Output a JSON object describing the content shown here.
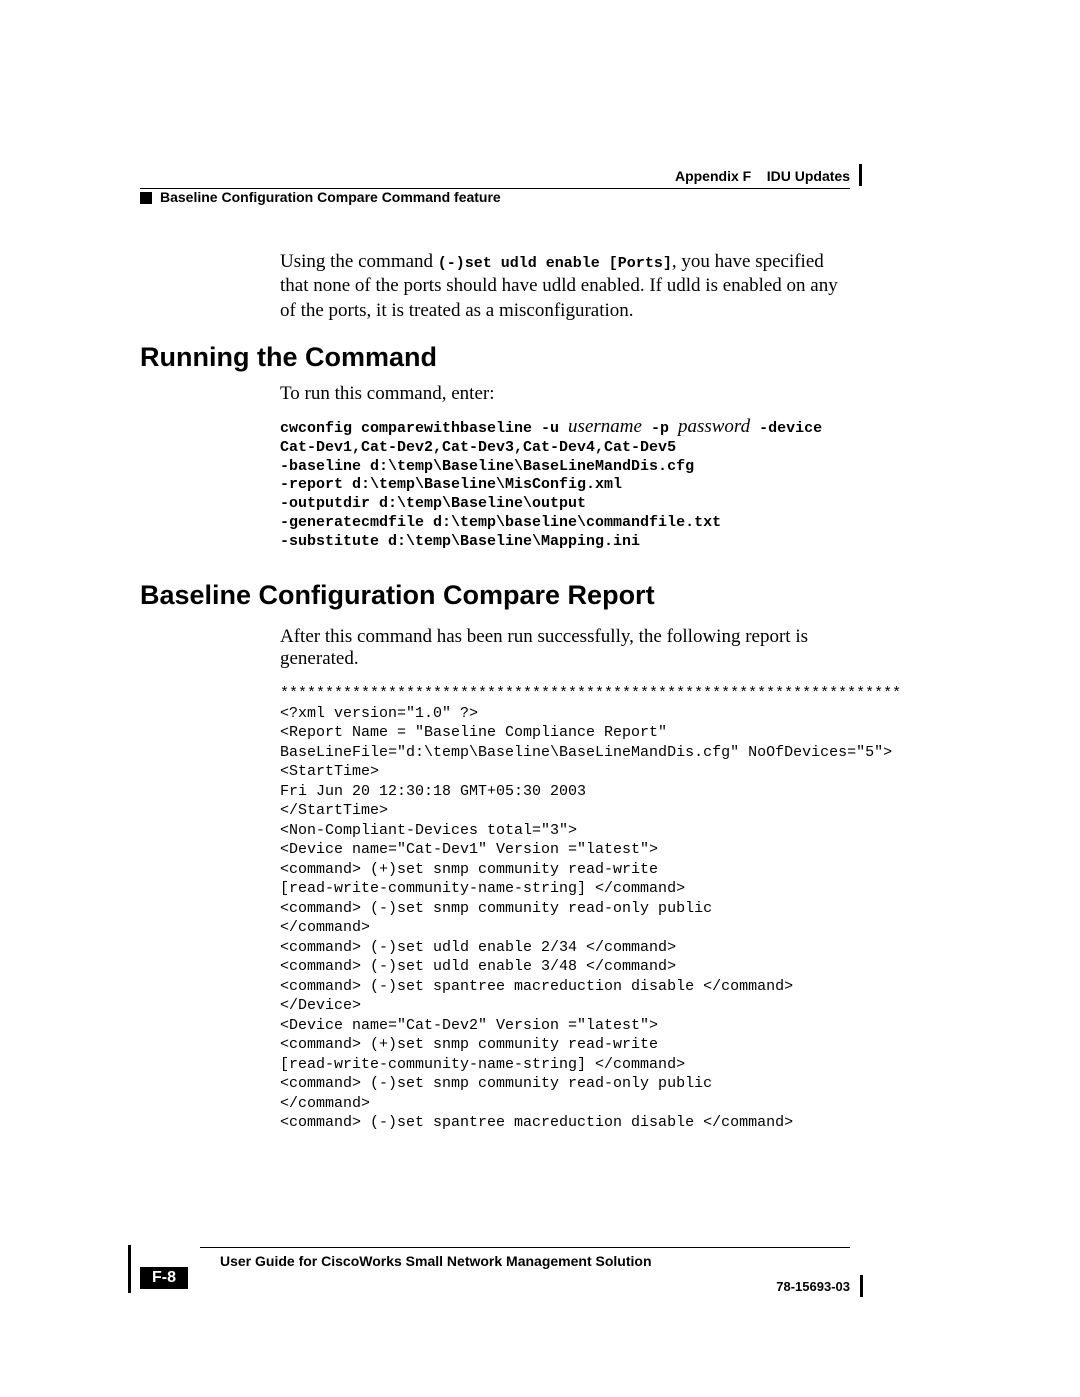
{
  "header": {
    "appendix": "Appendix F",
    "chapter": "IDU Updates",
    "section_marker_text": "Baseline Configuration Compare Command feature"
  },
  "intro": {
    "pre_text": "Using the command ",
    "command": "(-)set udld enable [Ports]",
    "post_text": ", you have specified that none of the ports should have udld enabled. If udld is enabled on any of the ports, it is treated as a misconfiguration."
  },
  "running": {
    "heading": "Running the Command",
    "intro": "To run this command, enter:",
    "l1a": "cwconfig comparewithbaseline -u ",
    "l1_user": "username",
    "l1b": " -p ",
    "l1_pass": "password",
    "l1c": " -device",
    "l2": "Cat-Dev1,Cat-Dev2,Cat-Dev3,Cat-Dev4,Cat-Dev5",
    "l3": "-baseline d:\\temp\\Baseline\\BaseLineMandDis.cfg",
    "l4": "-report d:\\temp\\Baseline\\MisConfig.xml",
    "l5": "-outputdir d:\\temp\\Baseline\\output",
    "l6": "-generatecmdfile d:\\temp\\baseline\\commandfile.txt",
    "l7": "-substitute d:\\temp\\Baseline\\Mapping.ini"
  },
  "report": {
    "heading": "Baseline Configuration Compare Report",
    "intro": "After this command has been run successfully, the following report is generated.",
    "listing": "*********************************************************************\n<?xml version=\"1.0\" ?>\n<Report Name = \"Baseline Compliance Report\"\nBaseLineFile=\"d:\\temp\\Baseline\\BaseLineMandDis.cfg\" NoOfDevices=\"5\">\n<StartTime>\nFri Jun 20 12:30:18 GMT+05:30 2003\n</StartTime>\n<Non-Compliant-Devices total=\"3\">\n<Device name=\"Cat-Dev1\" Version =\"latest\">\n<command> (+)set snmp community read-write\n[read-write-community-name-string] </command>\n<command> (-)set snmp community read-only public\n</command>\n<command> (-)set udld enable 2/34 </command>\n<command> (-)set udld enable 3/48 </command>\n<command> (-)set spantree macreduction disable </command>\n</Device>\n<Device name=\"Cat-Dev2\" Version =\"latest\">\n<command> (+)set snmp community read-write\n[read-write-community-name-string] </command>\n<command> (-)set snmp community read-only public\n</command>\n<command> (-)set spantree macreduction disable </command>"
  },
  "footer": {
    "guide": "User Guide for CiscoWorks Small Network Management Solution",
    "page": "F-8",
    "docnum": "78-15693-03"
  }
}
